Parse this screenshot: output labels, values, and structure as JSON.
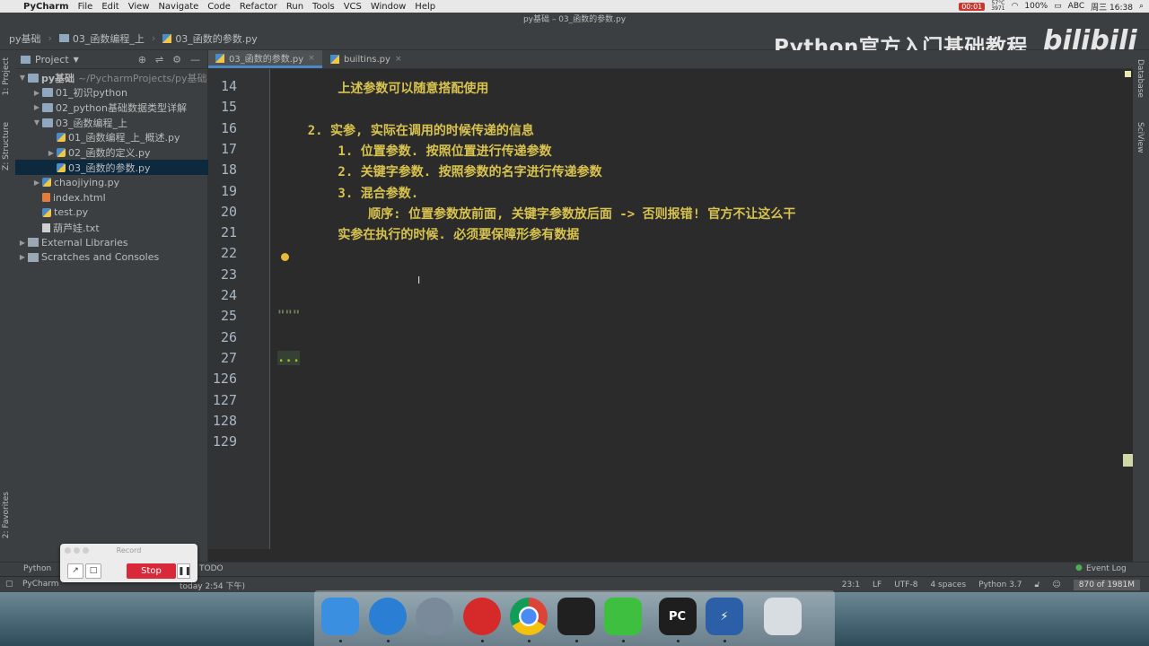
{
  "menubar": {
    "app": "PyCharm",
    "items": [
      "File",
      "Edit",
      "View",
      "Navigate",
      "Code",
      "Refactor",
      "Run",
      "Tools",
      "VCS",
      "Window",
      "Help"
    ],
    "rec_time": "00:01",
    "temp": "57°C",
    "temp2": "3971",
    "battery": "100%",
    "input": "ABC",
    "clock": "周三 16:38"
  },
  "window": {
    "title": "py基础 – 03_函数的参数.py"
  },
  "navbar": {
    "crumbs": [
      "py基础",
      "03_函数编程_上",
      "03_函数的参数.py"
    ]
  },
  "watermark": {
    "text": "Python官方入门基础教程",
    "brand": "bilibili"
  },
  "left_stripe": {
    "project_tab": "1: Project",
    "structure_tab": "Z: Structure",
    "favorites_tab": "2: Favorites"
  },
  "project": {
    "header": "Project",
    "tree": [
      {
        "label": "py基础",
        "extra": "~/PycharmProjects/py基础",
        "icon": "folder",
        "arrow": "▼",
        "indent": 0
      },
      {
        "label": "01_初识python",
        "icon": "folder",
        "arrow": "▶",
        "indent": 1
      },
      {
        "label": "02_python基础数据类型详解",
        "icon": "folder",
        "arrow": "▶",
        "indent": 1
      },
      {
        "label": "03_函数编程_上",
        "icon": "folder",
        "arrow": "▼",
        "indent": 1
      },
      {
        "label": "01_函数编程_上_概述.py",
        "icon": "py",
        "arrow": "",
        "indent": 2
      },
      {
        "label": "02_函数的定义.py",
        "icon": "py",
        "arrow": "▶",
        "indent": 2
      },
      {
        "label": "03_函数的参数.py",
        "icon": "py",
        "arrow": "",
        "indent": 2,
        "selected": true
      },
      {
        "label": "chaojiying.py",
        "icon": "py",
        "arrow": "▶",
        "indent": 1
      },
      {
        "label": "index.html",
        "icon": "html",
        "arrow": "",
        "indent": 1
      },
      {
        "label": "test.py",
        "icon": "py",
        "arrow": "",
        "indent": 1
      },
      {
        "label": "葫芦娃.txt",
        "icon": "txt",
        "arrow": "",
        "indent": 1
      },
      {
        "label": "External Libraries",
        "icon": "lib",
        "arrow": "▶",
        "indent": 0
      },
      {
        "label": "Scratches and Consoles",
        "icon": "lib",
        "arrow": "▶",
        "indent": 0
      }
    ]
  },
  "tabs": [
    {
      "label": "03_函数的参数.py",
      "active": true
    },
    {
      "label": "builtins.py",
      "active": false
    }
  ],
  "editor": {
    "lines": [
      {
        "no": "14",
        "text": "        上述参数可以随意搭配使用"
      },
      {
        "no": "15",
        "text": ""
      },
      {
        "no": "16",
        "text": "    2. 实参, 实际在调用的时候传递的信息"
      },
      {
        "no": "17",
        "text": "        1. 位置参数. 按照位置进行传递参数"
      },
      {
        "no": "18",
        "text": "        2. 关键字参数. 按照参数的名字进行传递参数"
      },
      {
        "no": "19",
        "text": "        3. 混合参数."
      },
      {
        "no": "20",
        "text": "            顺序: 位置参数放前面, 关键字参数放后面 -> 否则报错! 官方不让这么干"
      },
      {
        "no": "21",
        "text": "        实参在执行的时候. 必须要保障形参有数据"
      },
      {
        "no": "22",
        "text": ""
      },
      {
        "no": "23",
        "text": ""
      },
      {
        "no": "24",
        "text": ""
      },
      {
        "no": "25",
        "text": "\"\"\""
      },
      {
        "no": "26",
        "text": ""
      },
      {
        "no": "27",
        "text": "..."
      },
      {
        "no": "126",
        "text": ""
      },
      {
        "no": "127",
        "text": ""
      },
      {
        "no": "128",
        "text": ""
      },
      {
        "no": "129",
        "text": ""
      }
    ]
  },
  "right_stripe": {
    "database_tab": "Database",
    "sciview_tab": "SciView"
  },
  "bottom": {
    "python_console": "Python",
    "todo": "TODO",
    "event_log": "Event Log"
  },
  "status": {
    "message": "PyCharm",
    "message_tail": "today 2:54 下午)",
    "position": "23:1",
    "line_sep": "LF",
    "encoding": "UTF-8",
    "indent": "4 spaces",
    "interpreter": "Python 3.7",
    "memory": "870 of 1981M"
  },
  "record": {
    "title": "Record",
    "stop": "Stop"
  },
  "dock": [
    {
      "name": "finder-icon",
      "color": "#3b8fe0",
      "label": ""
    },
    {
      "name": "safari-icon",
      "color": "#2a7fd4",
      "label": ""
    },
    {
      "name": "launchpad-icon",
      "color": "#7a8a9a",
      "label": ""
    },
    {
      "name": "netease-music-icon",
      "color": "#d62a2a",
      "label": ""
    },
    {
      "name": "chrome-icon",
      "color": "#e8e8e8",
      "label": ""
    },
    {
      "name": "qq-icon",
      "color": "#202020",
      "label": ""
    },
    {
      "name": "wechat-icon",
      "color": "#3fbf3f",
      "label": ""
    },
    {
      "name": "pycharm-icon",
      "color": "#1e1e1e",
      "label": "PC"
    },
    {
      "name": "reeder-icon",
      "color": "#2b5fa8",
      "label": "⚡"
    },
    {
      "name": "trash-icon",
      "color": "#d8dde2",
      "label": ""
    }
  ]
}
